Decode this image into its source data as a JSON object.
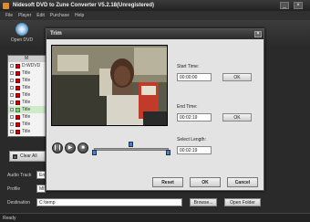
{
  "window": {
    "title": "Nidesoft DVD to Zune Converter V5.2.18(Unregistered)"
  },
  "menu": {
    "items": [
      "File",
      "Player",
      "Edit",
      "Purchase",
      "Help"
    ]
  },
  "toolbar": {
    "open_dvd": "Open DVD"
  },
  "list": {
    "header": "M",
    "rows": [
      {
        "label": "D:WDVD",
        "selected": false
      },
      {
        "label": "Title",
        "selected": false
      },
      {
        "label": "Title",
        "selected": false
      },
      {
        "label": "Title",
        "selected": false
      },
      {
        "label": "Title",
        "selected": false
      },
      {
        "label": "Title",
        "selected": false
      },
      {
        "label": "Title",
        "selected": true
      },
      {
        "label": "Title",
        "selected": false
      },
      {
        "label": "Title",
        "selected": false
      },
      {
        "label": "Title",
        "selected": false
      }
    ]
  },
  "clear_all": "Clear All",
  "lower": {
    "audio_track_label": "Audio Track",
    "audio_track_value": "En",
    "profile_label": "Profile",
    "profile_value": "MI",
    "destination_label": "Destination",
    "destination_value": "C:\\temp",
    "browse": "Browse...",
    "open_folder": "Open Folder"
  },
  "status": {
    "text": "Ready"
  },
  "trim": {
    "title": "Trim",
    "start_time_label": "Start Time:",
    "start_time_value": "00:00:00",
    "end_time_label": "End Time:",
    "end_time_value": "00:02:19",
    "select_length_label": "Select Length:",
    "select_length_value": "00:02:19",
    "ok_small": "OK",
    "reset": "Reset",
    "ok": "OK",
    "cancel": "Cancel"
  },
  "colors": {
    "accent": "#4a7fd0",
    "dialog_bg": "#e3e3e3",
    "title_bar": "#2a2a2a"
  }
}
